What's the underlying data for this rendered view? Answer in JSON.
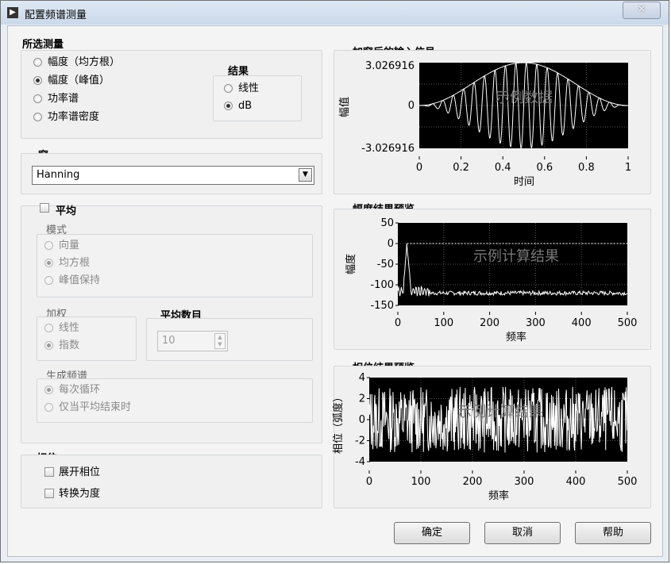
{
  "window": {
    "title": "配置频谱测量",
    "close_label": "×"
  },
  "measurement": {
    "title": "所选测量",
    "options": [
      "幅度（均方根）",
      "幅度（峰值）",
      "功率谱",
      "功率谱密度"
    ],
    "selected": 1
  },
  "result": {
    "title": "结果",
    "options": [
      "线性",
      "dB"
    ],
    "selected": 1
  },
  "window_func": {
    "title": "窗",
    "value": "Hanning"
  },
  "averaging": {
    "checkbox_label": "平均",
    "mode_title": "模式",
    "mode_options": [
      "向量",
      "均方根",
      "峰值保持"
    ],
    "mode_selected": 1,
    "weight_title": "加权",
    "weight_options": [
      "线性",
      "指数"
    ],
    "weight_selected": 1,
    "count_title": "平均数目",
    "count_value": "10",
    "spectrum_title": "生成频谱",
    "spectrum_options": [
      "每次循环",
      "仅当平均结束时"
    ],
    "spectrum_selected": 0
  },
  "phase": {
    "title": "相位",
    "unwrap_label": "展开相位",
    "degrees_label": "转换为度"
  },
  "buttons": {
    "ok": "确定",
    "cancel": "取消",
    "help": "帮助"
  },
  "chart_data": [
    {
      "type": "line",
      "title": "加窗后的输入信号",
      "xlabel": "时间",
      "ylabel": "幅值",
      "xlim": [
        0,
        1
      ],
      "ylim": [
        -3.026916,
        3.026916
      ],
      "x_ticks": [
        "0",
        "0.2",
        "0.4",
        "0.6",
        "0.8",
        "1"
      ],
      "y_ticks": [
        "3.026916",
        "0",
        "-3.026916"
      ],
      "watermark": "示例数据",
      "series": [
        {
          "description": "Hanning-windowed sine, 20 cycles, peak 3.026916",
          "cycles": 20,
          "peak": 3.026916
        }
      ]
    },
    {
      "type": "line",
      "title": "幅度结果预览",
      "xlabel": "频率",
      "ylabel": "幅度",
      "xlim": [
        0,
        500
      ],
      "ylim": [
        -150,
        50
      ],
      "x_ticks": [
        "0",
        "100",
        "200",
        "300",
        "400",
        "500"
      ],
      "y_ticks": [
        "50",
        "0",
        "-50",
        "-100",
        "-150"
      ],
      "watermark": "示例计算结果",
      "peak": {
        "x": 20,
        "y": 0
      },
      "noise_floor": -120
    },
    {
      "type": "line",
      "title": "相位结果预览",
      "xlabel": "频率",
      "ylabel": "相位（弧度）",
      "xlim": [
        0,
        500
      ],
      "ylim": [
        -4,
        4
      ],
      "x_ticks": [
        "0",
        "100",
        "200",
        "300",
        "400",
        "500"
      ],
      "y_ticks": [
        "4",
        "2",
        "0",
        "-2",
        "-4"
      ],
      "watermark": "示例计算结果"
    }
  ]
}
